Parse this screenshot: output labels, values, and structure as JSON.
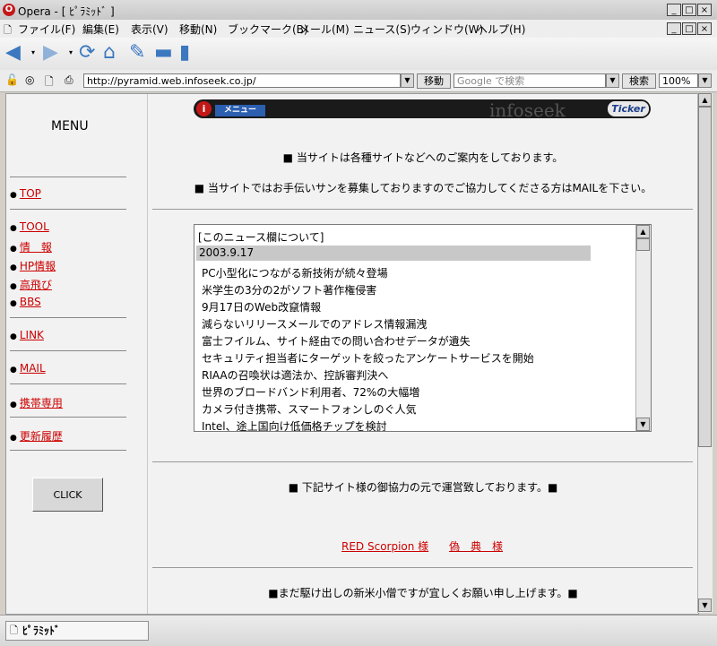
{
  "window": {
    "title": "Opera - [ ﾋﾟﾗﾐｯﾄﾞ ]",
    "controls": {
      "minimize": "_",
      "maximize": "□",
      "close": "×"
    }
  },
  "menubar": {
    "items": [
      "ファイル(F)",
      "編集(E)",
      "表示(V)",
      "移動(N)",
      "ブックマーク(B)",
      "メール(M)",
      "ニュース(S)",
      "ウィンドウ(W)",
      "ヘルプ(H)"
    ]
  },
  "address": {
    "url": "http://pyramid.web.infoseek.co.jp/",
    "go_label": "移動",
    "search_placeholder": "Google で検索",
    "search_label": "検索",
    "zoom": "100%"
  },
  "sidebar": {
    "title": "MENU",
    "groups": [
      [
        "TOP"
      ],
      [
        "TOOL",
        "情　報",
        "HP情報",
        "高飛び",
        "BBS"
      ],
      [
        "LINK"
      ],
      [
        "MAIL"
      ],
      [
        "携帯専用"
      ],
      [
        "更新履歴"
      ]
    ],
    "click_button": "CLICK"
  },
  "banner": {
    "logo": "i",
    "menu_tab": "メニュー",
    "brand": "infoseek",
    "ticker": "Ticker"
  },
  "main": {
    "intro1": "■ 当サイトは各種サイトなどへのご案内をしております。",
    "intro2": "■ 当サイトではお手伝いサンを募集しておりますのでご協力してくださる方はMAILを下さい。",
    "news": {
      "header": "[このニュース欄について]",
      "date": "2003.9.17",
      "items": [
        "PC小型化につながる新技術が続々登場",
        "米学生の3分の2がソフト著作権侵害",
        "9月17日のWeb改竄情報",
        "減らないリリースメールでのアドレス情報漏洩",
        "富士フイルム、サイト経由での問い合わせデータが遺失",
        "セキュリティ担当者にターゲットを絞ったアンケートサービスを開始",
        "RIAAの召喚状は適法か、控訴審判決へ",
        "世界のブロードバンド利用者、72%の大幅増",
        "カメラ付き携帯、スマートフォンしのぐ人気",
        "Intel、途上国向け低価格チップを検討"
      ]
    },
    "cooperation": "■ 下記サイト様の御協力の元で運営致しております。■",
    "partners": [
      "RED Scorpion 様",
      "偽　典　様"
    ],
    "closing": "■まだ駆け出しの新米小僧ですが宜しくお願い申し上げます。■"
  },
  "status": {
    "tab_label": "ﾋﾟﾗﾐｯﾄﾞ"
  }
}
